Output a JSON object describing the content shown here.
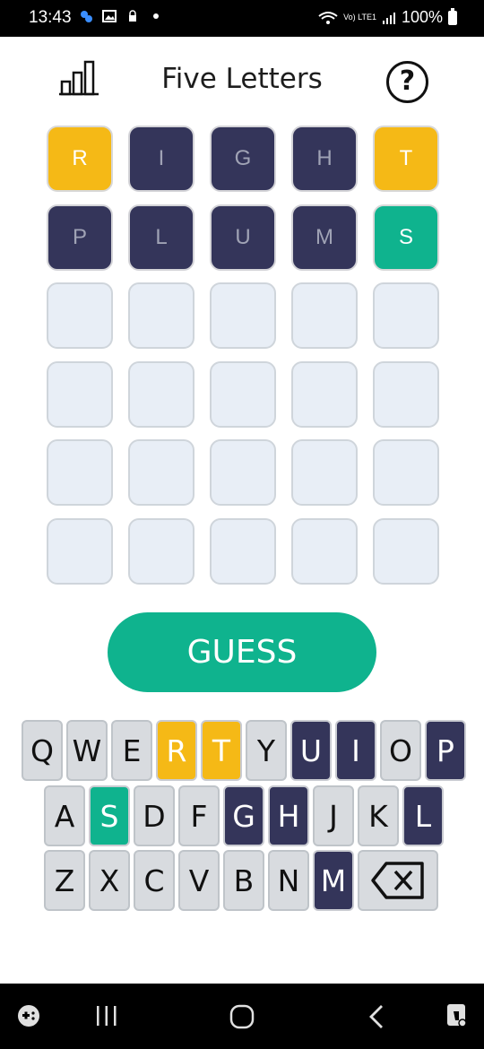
{
  "status_bar": {
    "time": "13:43",
    "network_label": "Vo) LTE1",
    "battery": "100%"
  },
  "header": {
    "title": "Five Letters"
  },
  "board": {
    "rows": [
      [
        {
          "letter": "R",
          "state": "present"
        },
        {
          "letter": "I",
          "state": "absent"
        },
        {
          "letter": "G",
          "state": "absent"
        },
        {
          "letter": "H",
          "state": "absent"
        },
        {
          "letter": "T",
          "state": "present"
        }
      ],
      [
        {
          "letter": "P",
          "state": "absent"
        },
        {
          "letter": "L",
          "state": "absent"
        },
        {
          "letter": "U",
          "state": "absent"
        },
        {
          "letter": "M",
          "state": "absent"
        },
        {
          "letter": "S",
          "state": "correct"
        }
      ],
      [
        {
          "letter": "",
          "state": "empty"
        },
        {
          "letter": "",
          "state": "empty"
        },
        {
          "letter": "",
          "state": "empty"
        },
        {
          "letter": "",
          "state": "empty"
        },
        {
          "letter": "",
          "state": "empty"
        }
      ],
      [
        {
          "letter": "",
          "state": "empty"
        },
        {
          "letter": "",
          "state": "empty"
        },
        {
          "letter": "",
          "state": "empty"
        },
        {
          "letter": "",
          "state": "empty"
        },
        {
          "letter": "",
          "state": "empty"
        }
      ],
      [
        {
          "letter": "",
          "state": "empty"
        },
        {
          "letter": "",
          "state": "empty"
        },
        {
          "letter": "",
          "state": "empty"
        },
        {
          "letter": "",
          "state": "empty"
        },
        {
          "letter": "",
          "state": "empty"
        }
      ],
      [
        {
          "letter": "",
          "state": "empty"
        },
        {
          "letter": "",
          "state": "empty"
        },
        {
          "letter": "",
          "state": "empty"
        },
        {
          "letter": "",
          "state": "empty"
        },
        {
          "letter": "",
          "state": "empty"
        }
      ]
    ]
  },
  "guess_button": {
    "label": "GUESS"
  },
  "keyboard": {
    "rows": [
      [
        {
          "key": "Q",
          "state": "unused"
        },
        {
          "key": "W",
          "state": "unused"
        },
        {
          "key": "E",
          "state": "unused"
        },
        {
          "key": "R",
          "state": "present"
        },
        {
          "key": "T",
          "state": "present"
        },
        {
          "key": "Y",
          "state": "unused"
        },
        {
          "key": "U",
          "state": "absent"
        },
        {
          "key": "I",
          "state": "absent"
        },
        {
          "key": "O",
          "state": "unused"
        },
        {
          "key": "P",
          "state": "absent"
        }
      ],
      [
        {
          "key": "A",
          "state": "unused"
        },
        {
          "key": "S",
          "state": "correct"
        },
        {
          "key": "D",
          "state": "unused"
        },
        {
          "key": "F",
          "state": "unused"
        },
        {
          "key": "G",
          "state": "absent"
        },
        {
          "key": "H",
          "state": "absent"
        },
        {
          "key": "J",
          "state": "unused"
        },
        {
          "key": "K",
          "state": "unused"
        },
        {
          "key": "L",
          "state": "absent"
        }
      ],
      [
        {
          "key": "Z",
          "state": "unused"
        },
        {
          "key": "X",
          "state": "unused"
        },
        {
          "key": "C",
          "state": "unused"
        },
        {
          "key": "V",
          "state": "unused"
        },
        {
          "key": "B",
          "state": "unused"
        },
        {
          "key": "N",
          "state": "unused"
        },
        {
          "key": "M",
          "state": "absent"
        }
      ]
    ],
    "backspace_icon": "backspace-icon"
  },
  "colors": {
    "correct": "#0fb38e",
    "present": "#f5b916",
    "absent": "#34355a",
    "empty": "#e8eef6",
    "unused_key": "#d8dbdf"
  },
  "nav_bar": {
    "icons": [
      "game-launcher-icon",
      "recent-apps-icon",
      "home-icon",
      "back-icon",
      "assistant-icon"
    ]
  }
}
